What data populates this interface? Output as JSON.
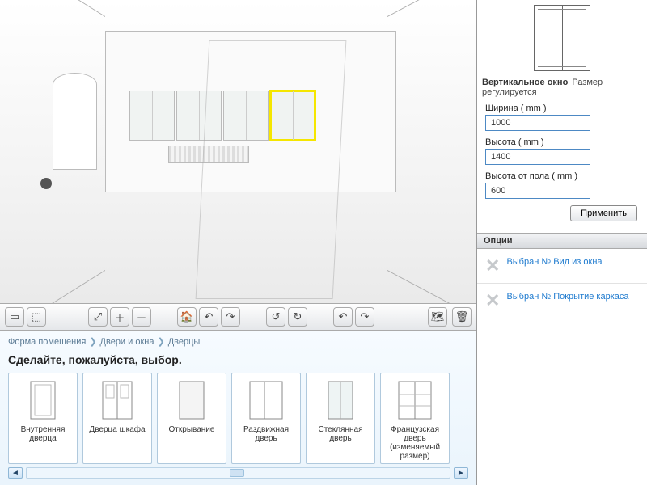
{
  "viewport": {
    "selected_object": "window-3"
  },
  "toolbar": {
    "view2d_tip": "2D",
    "view3d_tip": "3D",
    "zoomfit_tip": "По размеру",
    "zoomin_tip": "+",
    "zoomout_tip": "−",
    "home_tip": "Домой",
    "undo_tip": "Отменить",
    "redo_tip": "Повторить",
    "rotl_tip": "Повернуть влево",
    "rotr_tip": "Повернуть вправо",
    "pan_tip": "Панорама",
    "map_tip": "План",
    "delete_tip": "Удалить"
  },
  "crumbs": {
    "level1": "Форма помещения",
    "level2": "Двери и окна",
    "level3": "Дверцы"
  },
  "prompt": "Сделайте, пожалуйста, выбор.",
  "doors": [
    {
      "label": "Внутренняя дверца"
    },
    {
      "label": "Дверца шкафа"
    },
    {
      "label": "Открывание"
    },
    {
      "label": "Раздвижная дверь"
    },
    {
      "label": "Стеклянная дверь"
    },
    {
      "label": "Французская дверь (изменяемый размер)"
    }
  ],
  "properties": {
    "title": "Вертикальное окно",
    "subtitle": "Размер регулируется",
    "fields": {
      "width": {
        "label": "Ширина ( mm )",
        "value": "1000"
      },
      "height": {
        "label": "Высота ( mm )",
        "value": "1400"
      },
      "floor": {
        "label": "Высота от пола ( mm )",
        "value": "600"
      }
    },
    "apply": "Применить"
  },
  "options": {
    "heading": "Опции",
    "item1": "Выбран № Вид из окна",
    "item2": "Выбран № Покрытие каркаса"
  }
}
